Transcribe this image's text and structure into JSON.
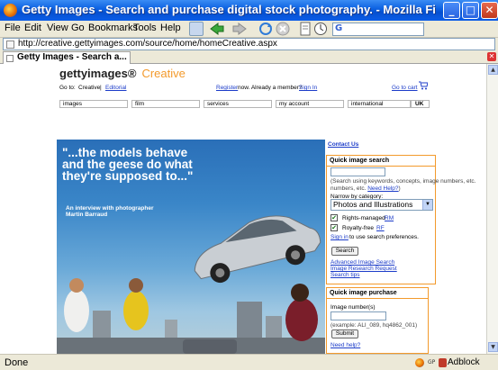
{
  "window": {
    "title": "Getty Images - Search and purchase digital stock photography. - Mozilla Firefox"
  },
  "menu": {
    "items": [
      "File",
      "Edit",
      "View",
      "Go",
      "Bookmarks",
      "Tools",
      "Help"
    ]
  },
  "address": {
    "url": "http://creative.gettyimages.com/source/home/homeCreative.aspx"
  },
  "tab": {
    "label": "Getty Images - Search a..."
  },
  "page": {
    "logo_main": "gettyimages®",
    "logo_sub": "Creative",
    "goto_label": "Go to:",
    "goto_creative": "Creative",
    "goto_sep": "|",
    "goto_editorial": "Editorial",
    "register_link": "Register",
    "register_text": "now. Already a member?",
    "signin_link": "Sign In",
    "goto_cart": "Go to cart",
    "nav": [
      "images",
      "film",
      "services",
      "my account",
      "international"
    ],
    "nav_region": "UK",
    "contact_us": "Contact Us",
    "hero_quote": "\"...the models behave and the geese do what they're supposed to...\"",
    "hero_sub_line1": "An interview with photographer",
    "hero_sub_line2": "Martin Barraud"
  },
  "quick_search": {
    "heading": "Quick image search",
    "hint": "(Search using keywords, concepts, image numbers, etc.",
    "need_help": "Need Help?",
    "hint_close": ")",
    "narrow_label": "Narrow by category:",
    "category_value": "Photos and Illustrations",
    "rm_label": "Rights-managed",
    "rm_abbr": "RM",
    "rf_label": "Royalty-free",
    "rf_abbr": "RF",
    "signin_pref_link": "Sign in",
    "signin_pref_text": "to use search preferences.",
    "search_button": "Search",
    "advanced_link": "Advanced Image Search",
    "research_link": "Image Research Request",
    "tips_link": "Search tips"
  },
  "quick_purchase": {
    "heading": "Quick image purchase",
    "number_label": "Image number(s)",
    "example": "(example: ALI_089, hq4862_001)",
    "submit_button": "Submit",
    "need_help": "Need help?"
  },
  "status": {
    "text": "Done",
    "gp": "GP",
    "adblock": "Adblock"
  }
}
